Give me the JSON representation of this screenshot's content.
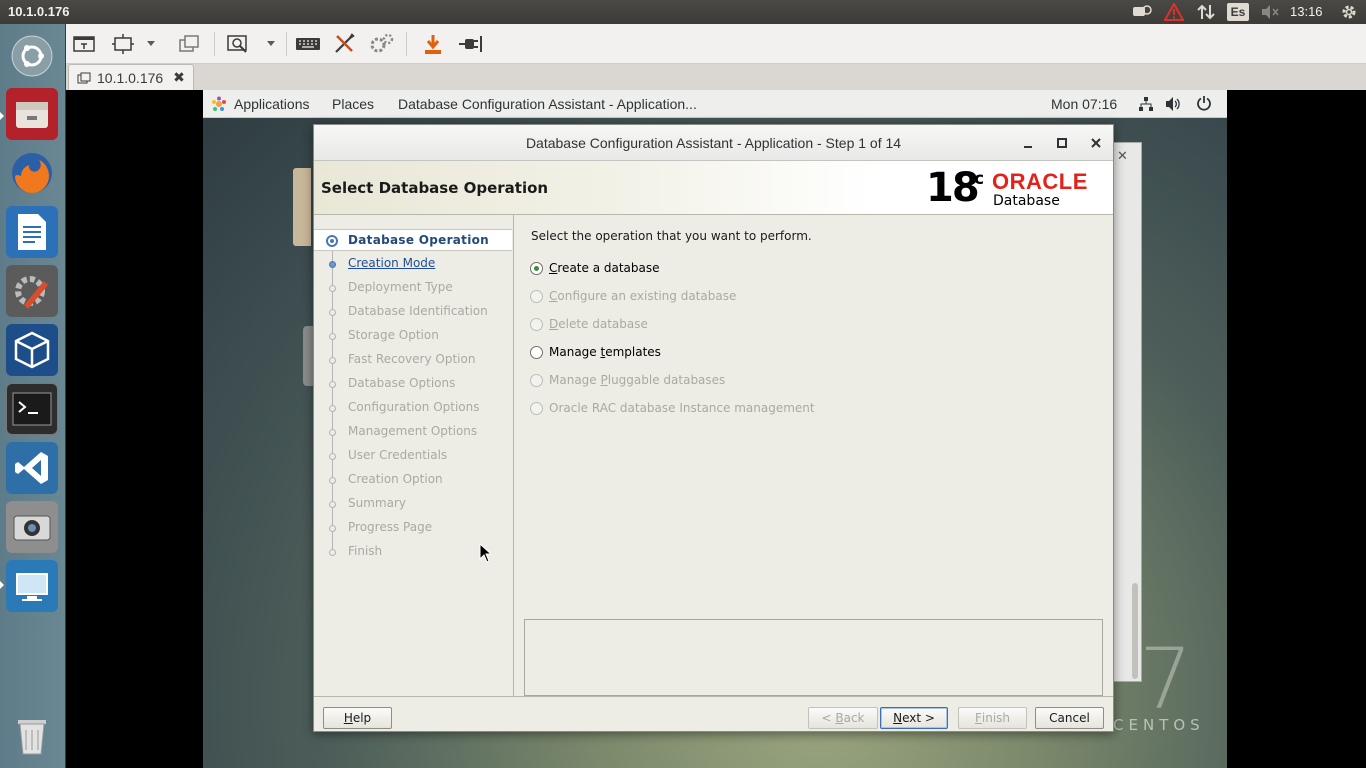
{
  "top_panel": {
    "title": "10.1.0.176",
    "keyboard_layout": "Es",
    "clock": "13:16"
  },
  "launcher": {
    "items": [
      "ubuntu-dash",
      "files",
      "firefox",
      "libreoffice-writer",
      "system-settings",
      "virtualbox",
      "terminal",
      "vscode",
      "screenshot",
      "remote-viewer",
      "trash"
    ]
  },
  "viewer": {
    "tab_label": "10.1.0.176",
    "tab_close": "✖"
  },
  "gnome_bar": {
    "applications": "Applications",
    "places": "Places",
    "window_title": "Database Configuration Assistant - Application...",
    "clock": "Mon 07:16"
  },
  "desktop": {
    "brand": "CENTOS",
    "version": "7"
  },
  "dbca": {
    "title": "Database Configuration Assistant - Application - Step 1 of 14",
    "page_heading": "Select Database Operation",
    "logo": {
      "version": "18",
      "suffix": "c",
      "brand": "ORACLE",
      "product": "Database",
      "brand_color": "#e3231b"
    },
    "steps": [
      {
        "label": "Database Operation",
        "state": "active"
      },
      {
        "label": "Creation Mode",
        "state": "link"
      },
      {
        "label": "Deployment Type",
        "state": "disabled"
      },
      {
        "label": "Database Identification",
        "state": "disabled"
      },
      {
        "label": "Storage Option",
        "state": "disabled"
      },
      {
        "label": "Fast Recovery Option",
        "state": "disabled"
      },
      {
        "label": "Database Options",
        "state": "disabled"
      },
      {
        "label": "Configuration Options",
        "state": "disabled"
      },
      {
        "label": "Management Options",
        "state": "disabled"
      },
      {
        "label": "User Credentials",
        "state": "disabled"
      },
      {
        "label": "Creation Option",
        "state": "disabled"
      },
      {
        "label": "Summary",
        "state": "disabled"
      },
      {
        "label": "Progress Page",
        "state": "disabled"
      },
      {
        "label": "Finish",
        "state": "disabled"
      }
    ],
    "prompt": "Select the operation that you want to perform.",
    "options": [
      {
        "pre": "",
        "mn": "C",
        "post": "reate a database",
        "selected": true,
        "enabled": true
      },
      {
        "pre": "",
        "mn": "C",
        "post": "onfigure an existing database",
        "selected": false,
        "enabled": false
      },
      {
        "pre": "",
        "mn": "D",
        "post": "elete database",
        "selected": false,
        "enabled": false
      },
      {
        "pre": "Manage ",
        "mn": "t",
        "post": "emplates",
        "selected": false,
        "enabled": true
      },
      {
        "pre": "Manage ",
        "mn": "P",
        "post": "luggable databases",
        "selected": false,
        "enabled": false
      },
      {
        "pre": "Oracle RAC database Instance management",
        "mn": "",
        "post": "",
        "selected": false,
        "enabled": false
      }
    ],
    "buttons": {
      "help": {
        "mn": "H",
        "rest": "elp"
      },
      "back": {
        "pre": "< ",
        "mn": "B",
        "rest": "ack"
      },
      "next": {
        "mn": "N",
        "rest": "ext >"
      },
      "finish": {
        "mn": "F",
        "rest": "inish"
      },
      "cancel": "Cancel"
    }
  }
}
